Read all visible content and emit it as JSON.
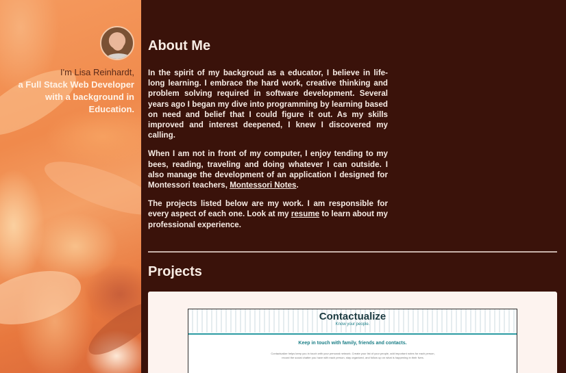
{
  "profile": {
    "intro_line1": "I'm Lisa Reinhardt,",
    "intro_line2": "a Full Stack Web Developer",
    "intro_line3": "with a background in Education."
  },
  "about": {
    "heading": "About Me",
    "p1": "In the spirit of my backgroud as a educator, I believe in life-long learning. I embrace the hard work, creative thinking and problem solving required in software development. Several years ago I began my dive into programming by learning based on need and belief that I could figure it out. As my skills improved and interest deepened, I knew I discovered my calling.",
    "p2_before": "When I am not in front of my computer, I enjoy tending to my bees, reading, traveling and doing whatever I can outside. I also manage the development of an application I designed for Montessori teachers, ",
    "p2_link": "Montessori Notes",
    "p2_after": ".",
    "p3_before": "The projects listed below are my work. I am responsible for every aspect of each one. Look at my ",
    "p3_link": "resume",
    "p3_after": " to learn about my professional experience."
  },
  "projects": {
    "heading": "Projects",
    "items": [
      {
        "title": "Contactualize",
        "tagline": "Know your people.",
        "hero": "Keep in touch with family, friends and contacts.",
        "body": "Contactualize helps keep you in touch with your personal network. Create your list of your people, add important notes for each person, record the social chatter you have with each person, stay organized, and follow up on what is happening in their lives."
      }
    ]
  },
  "colors": {
    "main_bg": "#3a120a",
    "sidebar_orange": "#f08a4c",
    "card_bg": "#fdf3ef",
    "accent_teal": "#1a7e86"
  }
}
